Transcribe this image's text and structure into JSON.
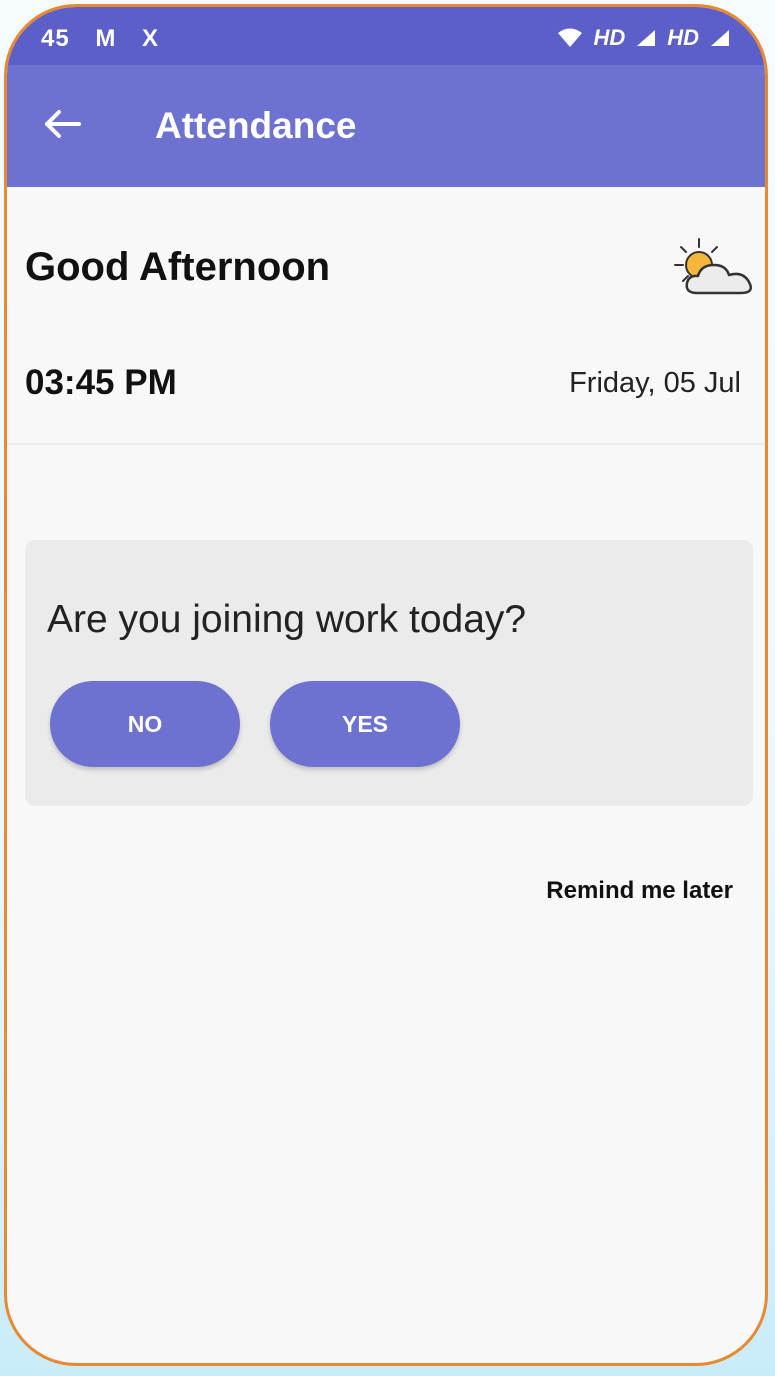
{
  "status_bar": {
    "left_items": [
      "45",
      "M",
      "X"
    ],
    "right_items": [
      "HD",
      "HD"
    ]
  },
  "app_bar": {
    "back_icon": "arrow-left-icon",
    "title": "Attendance"
  },
  "header": {
    "greeting": "Good Afternoon",
    "weather_icon": "partly-cloudy-icon",
    "time": "03:45 PM",
    "date": "Friday, 05 Jul"
  },
  "prompt_card": {
    "question": "Are you joining work today?",
    "no_label": "NO",
    "yes_label": "YES"
  },
  "remind_label": "Remind me later",
  "colors": {
    "status_bar": "#5c5fc7",
    "primary": "#6d71cf",
    "card_background": "#ebebeb",
    "frame_border": "#e8892f"
  }
}
